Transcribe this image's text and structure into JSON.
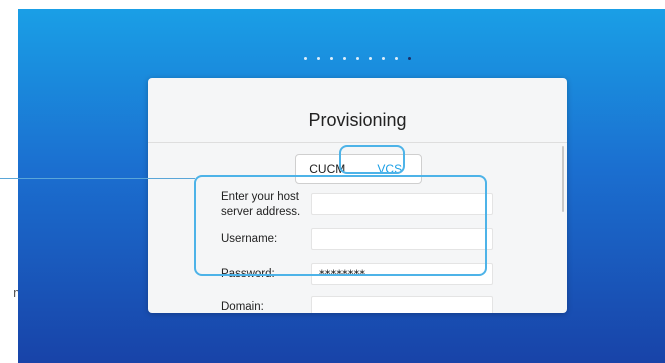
{
  "side_label": "m",
  "progress": {
    "total": 9,
    "active_index": 8
  },
  "dialog": {
    "title": "Provisioning",
    "tabs": [
      {
        "label": "CUCM",
        "selected": false
      },
      {
        "label": "VCS",
        "selected": true
      }
    ],
    "fields": [
      {
        "label": "Enter your host server address.",
        "value": ""
      },
      {
        "label": "Username:",
        "value": ""
      },
      {
        "label": "Password:",
        "value": "********"
      },
      {
        "label": "Domain:",
        "value": ""
      }
    ]
  },
  "colors": {
    "accent": "#1a9fe6",
    "highlight": "#4db3e8"
  }
}
